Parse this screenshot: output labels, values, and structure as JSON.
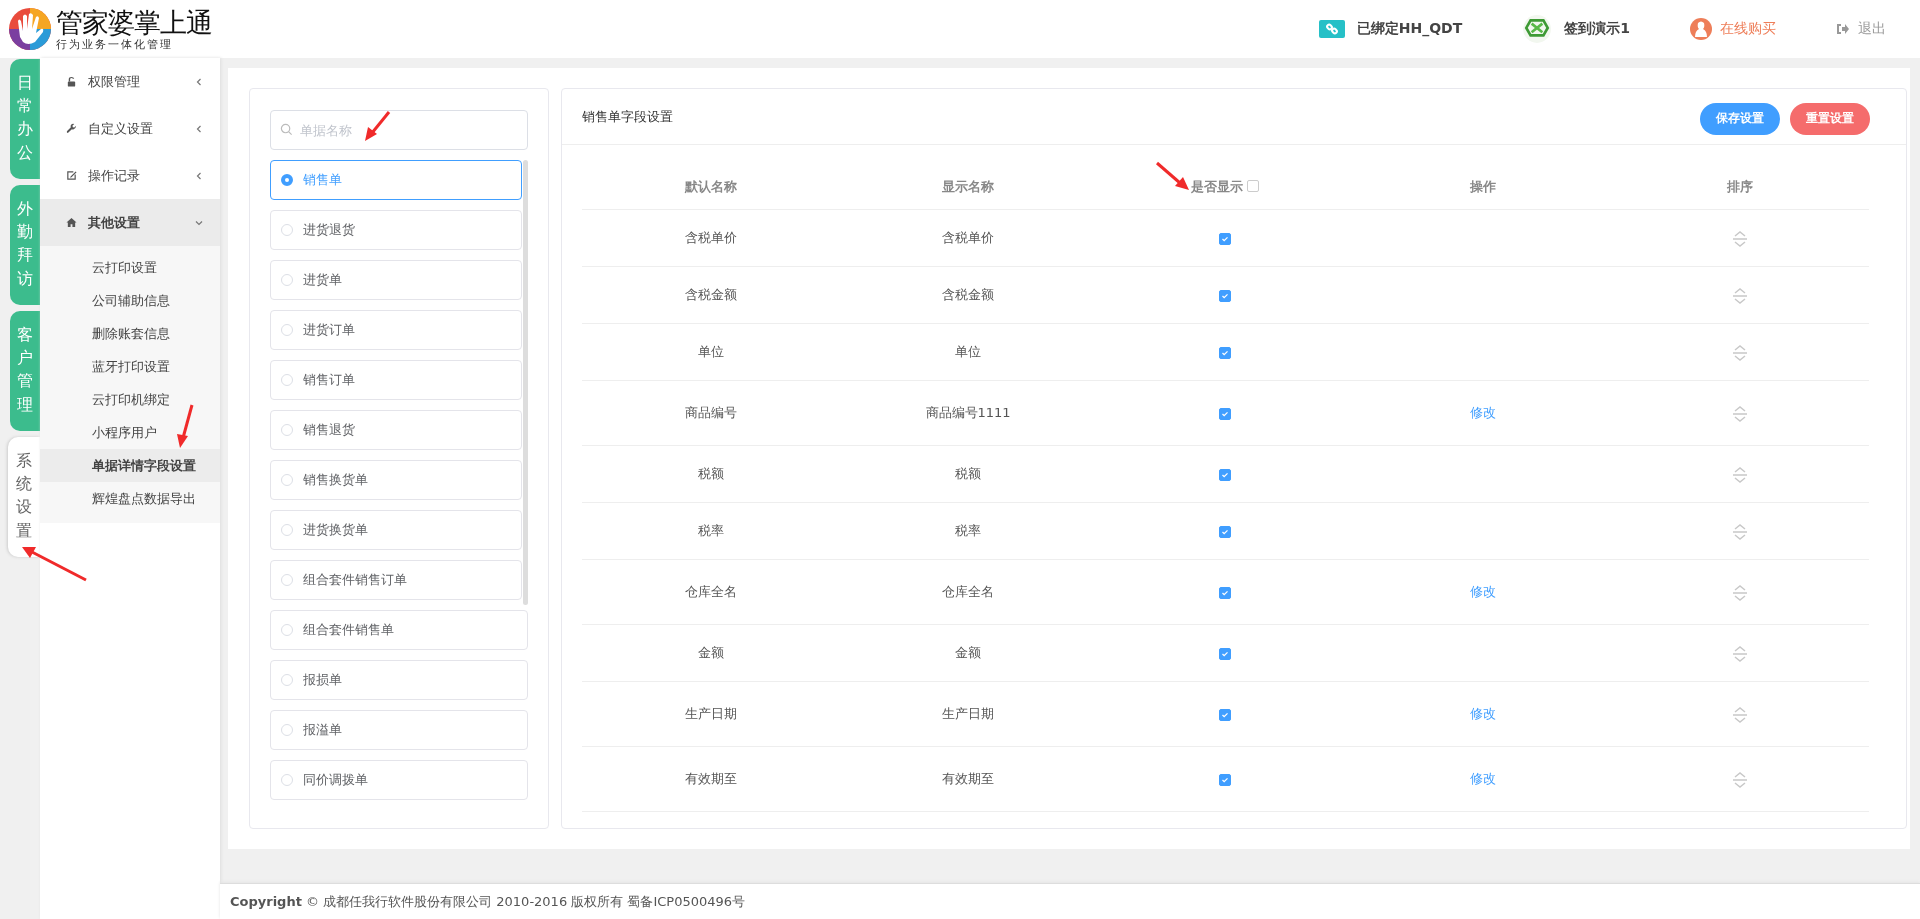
{
  "header": {
    "logo_title": "管家婆掌上通",
    "logo_subtitle": "行为业务一体化管理",
    "bound": "已绑定HH_QDT",
    "user": "签到演示1",
    "buy": "在线购买",
    "logout": "退出"
  },
  "side_tabs": [
    {
      "label": "日常办公",
      "selected": false
    },
    {
      "label": "外勤拜访",
      "selected": false
    },
    {
      "label": "客户管理",
      "selected": false
    },
    {
      "label": "系统设置",
      "selected": true
    }
  ],
  "menu": [
    {
      "label": "权限管理",
      "kind": "lock",
      "expanded": false
    },
    {
      "label": "自定义设置",
      "kind": "wrench",
      "expanded": false
    },
    {
      "label": "操作记录",
      "kind": "edit",
      "expanded": false
    },
    {
      "label": "其他设置",
      "kind": "home",
      "expanded": true,
      "children": [
        {
          "label": "云打印设置",
          "selected": false
        },
        {
          "label": "公司辅助信息",
          "selected": false
        },
        {
          "label": "删除账套信息",
          "selected": false
        },
        {
          "label": "蓝牙打印设置",
          "selected": false
        },
        {
          "label": "云打印机绑定",
          "selected": false
        },
        {
          "label": "小程序用户",
          "selected": false
        },
        {
          "label": "单据详情字段设置",
          "selected": true
        },
        {
          "label": "辉煌盘点数据导出",
          "selected": false
        }
      ]
    }
  ],
  "search": {
    "placeholder": "单据名称"
  },
  "doc_types": [
    {
      "label": "销售单",
      "selected": true
    },
    {
      "label": "进货退货",
      "selected": false
    },
    {
      "label": "进货单",
      "selected": false
    },
    {
      "label": "进货订单",
      "selected": false
    },
    {
      "label": "销售订单",
      "selected": false
    },
    {
      "label": "销售退货",
      "selected": false
    },
    {
      "label": "销售换货单",
      "selected": false
    },
    {
      "label": "进货换货单",
      "selected": false
    },
    {
      "label": "组合套件销售订单",
      "selected": false
    },
    {
      "label": "组合套件销售单",
      "selected": false
    },
    {
      "label": "报损单",
      "selected": false
    },
    {
      "label": "报溢单",
      "selected": false
    },
    {
      "label": "同价调拨单",
      "selected": false
    }
  ],
  "panel": {
    "title": "销售单字段设置",
    "buttons": [
      {
        "label": "保存设置",
        "kind": "primary"
      },
      {
        "label": "重置设置",
        "kind": "danger"
      }
    ]
  },
  "table": {
    "columns": [
      "默认名称",
      "显示名称",
      "是否显示",
      "操作",
      "排序"
    ],
    "show_all_checked": false,
    "rows": [
      {
        "default_name": "含税单价",
        "display_name": "含税单价",
        "visible": true
      },
      {
        "default_name": "含税金额",
        "display_name": "含税金额",
        "visible": true
      },
      {
        "default_name": "单位",
        "display_name": "单位",
        "visible": true
      },
      {
        "default_name": "商品编号",
        "display_name": "商品编号1111",
        "visible": true,
        "action": "修改"
      },
      {
        "default_name": "税额",
        "display_name": "税额",
        "visible": true
      },
      {
        "default_name": "税率",
        "display_name": "税率",
        "visible": true
      },
      {
        "default_name": "仓库全名",
        "display_name": "仓库全名",
        "visible": true,
        "action": "修改"
      },
      {
        "default_name": "金额",
        "display_name": "金额",
        "visible": true
      },
      {
        "default_name": "生产日期",
        "display_name": "生产日期",
        "visible": true,
        "action": "修改"
      },
      {
        "default_name": "有效期至",
        "display_name": "有效期至",
        "visible": true,
        "action": "修改"
      }
    ]
  },
  "footer": "**Copyright** © 成都任我行软件股份有限公司 2010-2016 版权所有 蜀备ICP0500496号"
}
